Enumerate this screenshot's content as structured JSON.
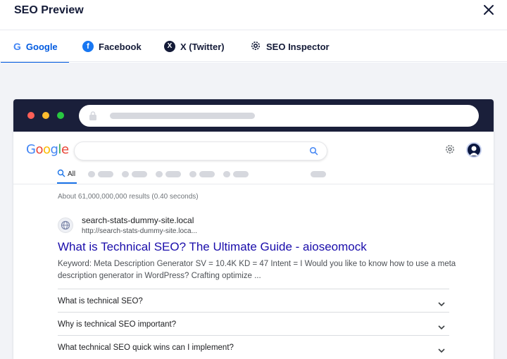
{
  "modal": {
    "title": "SEO Preview"
  },
  "tabs": [
    {
      "label": "Google",
      "icon": "google-icon",
      "active": true
    },
    {
      "label": "Facebook",
      "icon": "facebook-icon",
      "active": false
    },
    {
      "label": "X (Twitter)",
      "icon": "x-twitter-icon",
      "active": false
    },
    {
      "label": "SEO Inspector",
      "icon": "gear-icon",
      "active": false
    }
  ],
  "google": {
    "logo": "Google",
    "nav_all": "All",
    "stats": "About 61,000,000,000 results (0.40 seconds)"
  },
  "result": {
    "site_name": "search-stats-dummy-site.local",
    "url": "http://search-stats-dummy-site.loca...",
    "title": "What is Technical SEO? The Ultimate Guide - aioseomock",
    "description": "Keyword: Meta Description Generator SV = 10.4K KD = 47 Intent = I Would you like to know how to use a meta description generator in WordPress? Crafting optimize ..."
  },
  "faqs": [
    "What is technical SEO?",
    "Why is technical SEO important?",
    "What technical SEO quick wins can I implement?"
  ],
  "colors": {
    "accent": "#005ae0",
    "link": "#1a0dab",
    "browser_bar": "#1a1f3a",
    "traffic_red": "#ff5f57",
    "traffic_yellow": "#febc2e",
    "traffic_green": "#28c840"
  }
}
